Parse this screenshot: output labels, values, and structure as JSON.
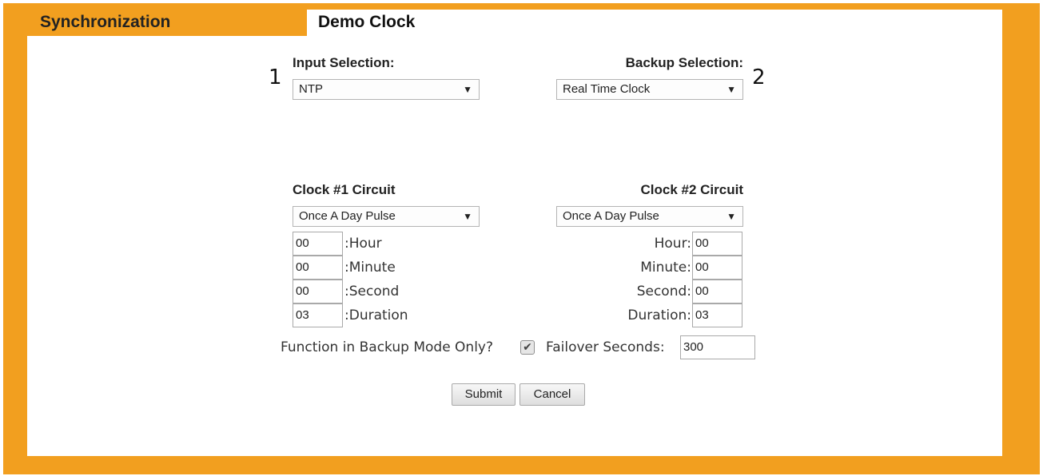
{
  "tabs": {
    "synchronization": "Synchronization",
    "demo_clock": "Demo Clock"
  },
  "markers": {
    "one": "1",
    "two": "2"
  },
  "input_selection": {
    "label": "Input Selection:",
    "value": "NTP"
  },
  "backup_selection": {
    "label": "Backup Selection:",
    "value": "Real Time Clock"
  },
  "clock1": {
    "title": "Clock #1 Circuit",
    "mode": "Once A Day Pulse",
    "hour": {
      "value": "00",
      "label": ":Hour"
    },
    "minute": {
      "value": "00",
      "label": ":Minute"
    },
    "second": {
      "value": "00",
      "label": ":Second"
    },
    "duration": {
      "value": "03",
      "label": ":Duration"
    }
  },
  "clock2": {
    "title": "Clock #2 Circuit",
    "mode": "Once A Day Pulse",
    "hour": {
      "value": "00",
      "label": "Hour:"
    },
    "minute": {
      "value": "00",
      "label": "Minute:"
    },
    "second": {
      "value": "00",
      "label": "Second:"
    },
    "duration": {
      "value": "03",
      "label": "Duration:"
    }
  },
  "backup_only": {
    "label": "Function in Backup Mode Only?",
    "checked": true,
    "check_glyph": "✔"
  },
  "failover": {
    "label": "Failover Seconds:",
    "value": "300"
  },
  "buttons": {
    "submit": "Submit",
    "cancel": "Cancel"
  },
  "icons": {
    "dropdown": "▼"
  },
  "colors": {
    "frame": "#f29f1f",
    "panel": "#ffffff"
  }
}
